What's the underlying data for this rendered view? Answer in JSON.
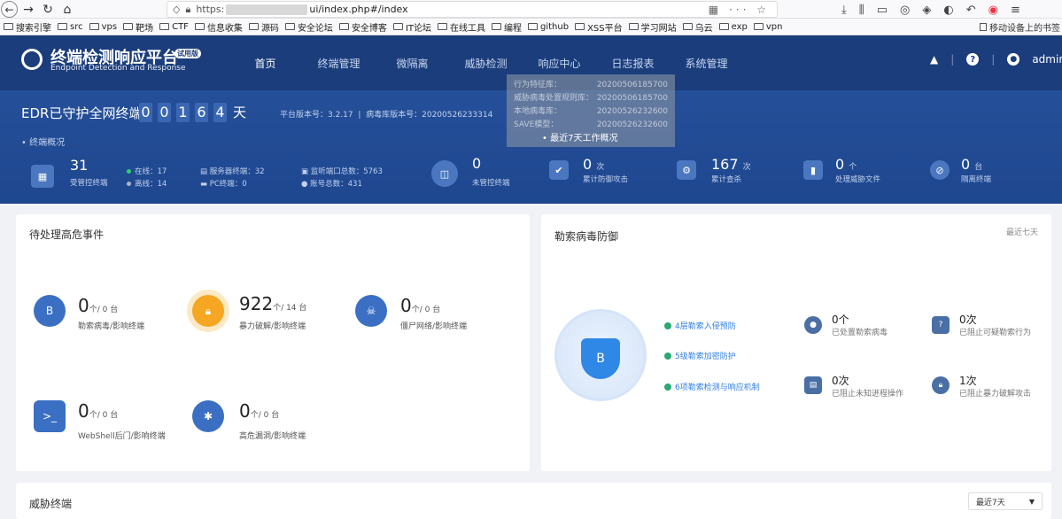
{
  "browser": {
    "url_prefix": "https:",
    "url_suffix": "ui/index.php#/index",
    "url_menu": "···",
    "bookmarks": [
      "搜索引擎",
      "src",
      "vps",
      "靶场",
      "CTF",
      "信息收集",
      "源码",
      "安全论坛",
      "安全博客",
      "IT论坛",
      "在线工具",
      "编程",
      "github",
      "XSS平台",
      "学习网站",
      "乌云",
      "exp",
      "vpn"
    ],
    "mobile_bookmarks": "移动设备上的书签"
  },
  "app": {
    "title": "终端检测响应平台",
    "trial": "试用版",
    "subtitle": "Endpoint Detection and Response",
    "nav": [
      "首页",
      "终端管理",
      "微隔离",
      "威胁检测",
      "响应中心",
      "日志报表",
      "系统管理"
    ],
    "user": "admin"
  },
  "banner": {
    "protect_text": "EDR已守护全网终端",
    "days_digits": [
      "0",
      "0",
      "1",
      "6",
      "4"
    ],
    "days_unit": "天",
    "platform_version": "平台版本号：3.2.17",
    "virus_db_version": "病毒库版本号：20200526233314",
    "overview_label": "• 终端概况",
    "popover": {
      "rows": [
        {
          "k": "行为特征库：",
          "v": "20200506185700"
        },
        {
          "k": "威胁病毒处置规则库：",
          "v": "20200506185700"
        },
        {
          "k": "本地病毒库：",
          "v": "20200526232600"
        },
        {
          "k": "SAVE模型：",
          "v": "20200526232600"
        }
      ],
      "recent": "• 最近7天工作概况"
    },
    "stats": {
      "managed": {
        "value": "31",
        "label": "受管控终端",
        "online": "在线：17",
        "offline": "离线：14",
        "server": "服务器终端：32",
        "pc": "PC终端：0",
        "ports": "监听端口总数：5763",
        "accounts": "账号总数：431"
      },
      "unmanaged": {
        "value": "0",
        "label": "未管控终端"
      },
      "attacks": {
        "value": "0",
        "unit": "次",
        "label": "累计防御攻击"
      },
      "scans": {
        "value": "167",
        "unit": "次",
        "label": "累计查杀"
      },
      "threat_files": {
        "value": "0",
        "unit": "个",
        "label": "处理威胁文件"
      },
      "isolated": {
        "value": "0",
        "unit": "台",
        "label": "隔离终端"
      }
    }
  },
  "events": {
    "title": "待处理高危事件",
    "items": [
      {
        "num": "0",
        "unit": "个/ 0 台",
        "label": "勒索病毒/影响终端"
      },
      {
        "num": "922",
        "unit": "个/ 14 台",
        "label": "暴力破解/影响终端"
      },
      {
        "num": "0",
        "unit": "个/ 0 台",
        "label": "僵尸网络/影响终端"
      },
      {
        "num": "0",
        "unit": "个/ 0 台",
        "label": "WebShell后门/影响终端"
      },
      {
        "num": "0",
        "unit": "个/ 0 台",
        "label": "高危漏洞/影响终端"
      }
    ]
  },
  "ransom": {
    "title": "勒索病毒防御",
    "period": "最近七天",
    "features": [
      "4层勒索入侵预防",
      "5级勒索加密防护",
      "6项勒索检测与响应机制"
    ],
    "stats": [
      {
        "num": "0个",
        "label": "已处置勒索病毒"
      },
      {
        "num": "0次",
        "label": "已阻止可疑勒索行为"
      },
      {
        "num": "0次",
        "label": "已阻止未知进程操作"
      },
      {
        "num": "1次",
        "label": "已阻止暴力破解攻击"
      }
    ]
  },
  "threat_endpoints": {
    "title": "威胁终端",
    "select": "最近7天"
  },
  "colors": {
    "header": "#1b3d7c",
    "banner": "#254f98",
    "accent": "#2f87e6"
  }
}
